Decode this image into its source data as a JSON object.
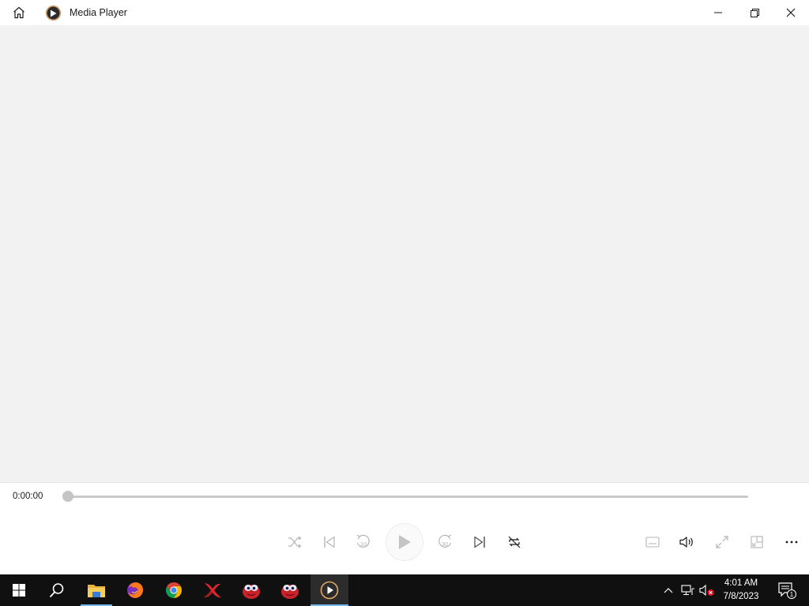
{
  "window": {
    "title": "Media Player",
    "icons": [
      "home-icon",
      "media-player-app-icon",
      "minimize-icon",
      "restore-icon",
      "close-icon"
    ]
  },
  "player": {
    "current_time": "0:00:00",
    "progress": 0,
    "skip_back_seconds": "10",
    "skip_forward_seconds": "30",
    "controls": [
      "shuffle",
      "previous",
      "skip-back-10",
      "play",
      "skip-forward-30",
      "next",
      "repeat-off",
      "captions",
      "volume",
      "full-screen",
      "mini-player",
      "more-options"
    ]
  },
  "taskbar": {
    "apps": [
      "start",
      "search",
      "file-explorer",
      "firefox",
      "chrome",
      "xampp",
      "app-red-1",
      "app-red-2",
      "media-player"
    ],
    "active_app": "media-player",
    "time": "4:01 AM",
    "date": "7/8/2023",
    "notification_count": "1"
  },
  "colors": {
    "titlebar_bg": "#ffffff",
    "video_bg": "#f2f2f2",
    "taskbar_bg": "#101010",
    "taskbar_accent": "#76b9ed"
  }
}
